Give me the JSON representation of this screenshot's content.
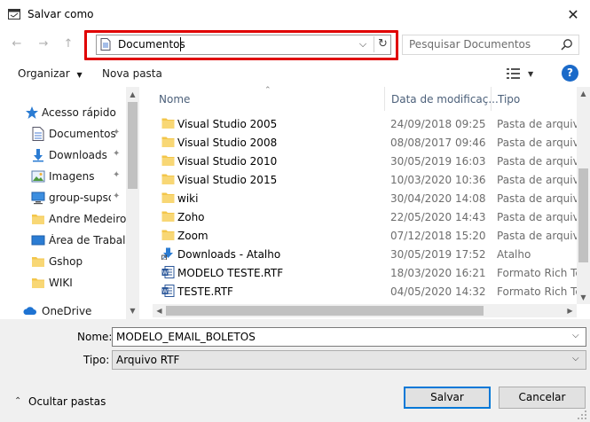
{
  "window": {
    "title": "Salvar como",
    "close_glyph": "✕"
  },
  "nav": {
    "back_glyph": "←",
    "forward_glyph": "→",
    "up_glyph": "↑",
    "address": "Documentos",
    "dropdown_glyph": "⌵",
    "refresh_glyph": "↻",
    "search_placeholder": "Pesquisar Documentos"
  },
  "toolbar": {
    "organize": "Organizar",
    "organize_caret": "▼",
    "new_folder": "Nova pasta",
    "view_caret": "▼",
    "help": "?"
  },
  "sidebar": {
    "items": [
      {
        "label": "Acesso rápido",
        "icon": "star-icon",
        "pinned": false
      },
      {
        "label": "Documentos",
        "icon": "document-icon",
        "pinned": true
      },
      {
        "label": "Downloads",
        "icon": "download-icon",
        "pinned": true
      },
      {
        "label": "Imagens",
        "icon": "images-icon",
        "pinned": true
      },
      {
        "label": "group-supsql",
        "icon": "computer-icon",
        "pinned": true
      },
      {
        "label": "Andre Medeiro",
        "icon": "folder-icon",
        "pinned": false
      },
      {
        "label": "Área de Trabalho",
        "icon": "desktop-icon",
        "pinned": false
      },
      {
        "label": "Gshop",
        "icon": "folder-icon",
        "pinned": false
      },
      {
        "label": "WIKI",
        "icon": "folder-icon",
        "pinned": false
      },
      {
        "label": "OneDrive",
        "icon": "cloud-icon",
        "pinned": false
      }
    ],
    "pin_glyph": "📌"
  },
  "files": {
    "columns": [
      "Nome",
      "Data de modificaç...",
      "Tipo"
    ],
    "rows": [
      {
        "name": "Visual Studio 2005",
        "date": "24/09/2018 09:25",
        "type": "Pasta de arquivos",
        "icon": "folder-icon"
      },
      {
        "name": "Visual Studio 2008",
        "date": "08/08/2017 09:46",
        "type": "Pasta de arquivos",
        "icon": "folder-icon"
      },
      {
        "name": "Visual Studio 2010",
        "date": "30/05/2019 16:03",
        "type": "Pasta de arquivos",
        "icon": "folder-icon"
      },
      {
        "name": "Visual Studio 2015",
        "date": "10/03/2020 10:36",
        "type": "Pasta de arquivos",
        "icon": "folder-icon"
      },
      {
        "name": "wiki",
        "date": "30/04/2020 14:08",
        "type": "Pasta de arquivos",
        "icon": "folder-icon"
      },
      {
        "name": "Zoho",
        "date": "22/05/2020 14:43",
        "type": "Pasta de arquivos",
        "icon": "folder-icon"
      },
      {
        "name": "Zoom",
        "date": "07/12/2018 15:20",
        "type": "Pasta de arquivos",
        "icon": "folder-icon"
      },
      {
        "name": "Downloads - Atalho",
        "date": "30/05/2019 17:52",
        "type": "Atalho",
        "icon": "shortcut-icon"
      },
      {
        "name": "MODELO TESTE.RTF",
        "date": "18/03/2020 16:21",
        "type": "Formato Rich Text",
        "icon": "word-doc-icon"
      },
      {
        "name": "TESTE.RTF",
        "date": "04/05/2020 14:32",
        "type": "Formato Rich Text",
        "icon": "word-doc-icon"
      }
    ]
  },
  "form": {
    "name_label": "Nome:",
    "name_value": "MODELO_EMAIL_BOLETOS",
    "type_label": "Tipo:",
    "type_value": "Arquivo RTF",
    "dropdown_glyph": "⌵"
  },
  "footer": {
    "hide_folders": "Ocultar pastas",
    "hide_glyph": "⌃",
    "save": "Salvar",
    "cancel": "Cancelar"
  },
  "colors": {
    "accent": "#0078d7",
    "highlight_border": "#e00000",
    "folder": "#f3c64a",
    "help_bg": "#1b6ac9"
  }
}
